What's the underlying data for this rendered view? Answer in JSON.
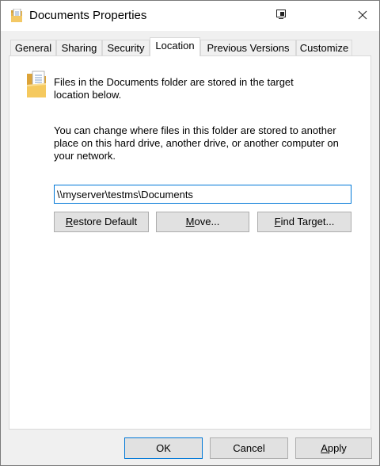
{
  "window": {
    "title": "Documents Properties"
  },
  "tabs": [
    {
      "label": "General",
      "active": false
    },
    {
      "label": "Sharing",
      "active": false
    },
    {
      "label": "Security",
      "active": false
    },
    {
      "label": "Location",
      "active": true
    },
    {
      "label": "Previous Versions",
      "active": false
    },
    {
      "label": "Customize",
      "active": false
    }
  ],
  "location": {
    "info_line1": "Files in the Documents folder are stored in the target",
    "info_line2": "location below.",
    "help_line1": "You can change where files in this folder are stored to another",
    "help_line2": "place on this hard drive, another drive, or another computer on",
    "help_line3": "your network.",
    "path_value": "\\\\myserver\\testms\\Documents",
    "restore_default": {
      "pre": "",
      "accel": "R",
      "post": "estore Default"
    },
    "move": {
      "pre": "",
      "accel": "M",
      "post": "ove..."
    },
    "find_target": {
      "pre": "",
      "accel": "F",
      "post": "ind Target..."
    }
  },
  "footer": {
    "ok": "OK",
    "cancel": "Cancel",
    "apply": {
      "pre": "",
      "accel": "A",
      "post": "pply"
    }
  },
  "icons": {
    "title": "documents-folder-icon",
    "pin": "pin-window-icon",
    "close": "close-icon",
    "folder": "documents-folder-icon"
  },
  "colors": {
    "accent": "#0078d7",
    "panel_bg": "#ffffff",
    "window_bg": "#f0f0f0",
    "button_bg": "#e1e1e1",
    "button_border": "#adadad"
  }
}
